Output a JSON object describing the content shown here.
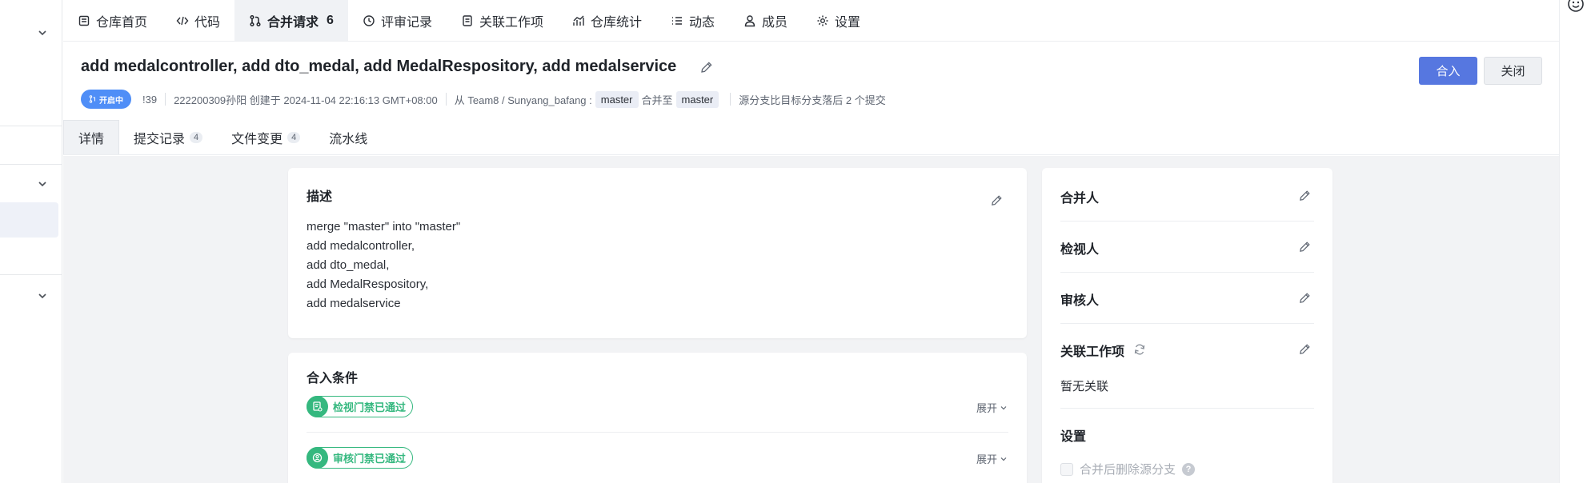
{
  "nav": {
    "tabs": [
      {
        "label": "仓库首页",
        "icon": "repo-home-icon"
      },
      {
        "label": "代码",
        "icon": "code-icon"
      },
      {
        "label": "合并请求",
        "icon": "merge-request-icon",
        "count": "6"
      },
      {
        "label": "评审记录",
        "icon": "review-icon"
      },
      {
        "label": "关联工作项",
        "icon": "workitem-icon"
      },
      {
        "label": "仓库统计",
        "icon": "stats-icon"
      },
      {
        "label": "动态",
        "icon": "activity-icon"
      },
      {
        "label": "成员",
        "icon": "member-icon"
      },
      {
        "label": "设置",
        "icon": "gear-icon"
      }
    ]
  },
  "mr": {
    "title": "add medalcontroller, add dto_medal, add MedalRespository, add medalservice",
    "status": "开启中",
    "id": "!39",
    "author_created": "222200309孙阳 创建于 2024-11-04 22:16:13 GMT+08:00",
    "from_label": "从 Team8 / Sunyang_bafang :",
    "source_branch": "master",
    "merge_to_label": "合并至",
    "target_branch": "master",
    "behind_text": "源分支比目标分支落后 2 个提交",
    "merge_button": "合入",
    "close_button": "关闭"
  },
  "subtabs": [
    {
      "label": "详情"
    },
    {
      "label": "提交记录",
      "count": "4"
    },
    {
      "label": "文件变更",
      "count": "4"
    },
    {
      "label": "流水线"
    }
  ],
  "description": {
    "heading": "描述",
    "lines": [
      "merge \"master\" into \"master\"",
      "add medalcontroller,",
      "add dto_medal,",
      "add MedalRespository,",
      "add medalservice"
    ]
  },
  "conditions": {
    "heading": "合入条件",
    "gates": [
      {
        "label": "检视门禁已通过",
        "expand": "展开"
      },
      {
        "label": "审核门禁已通过",
        "expand": "展开"
      }
    ]
  },
  "side": {
    "merger": "合并人",
    "reviewer": "检视人",
    "approver": "审核人",
    "workitems": "关联工作项",
    "no_link": "暂无关联",
    "settings": "设置",
    "delete_source": "合并后删除源分支",
    "help": "?"
  },
  "colors": {
    "primary": "#5677e0",
    "status_blue": "#4f8ef7",
    "gate_green": "#35b87f"
  }
}
